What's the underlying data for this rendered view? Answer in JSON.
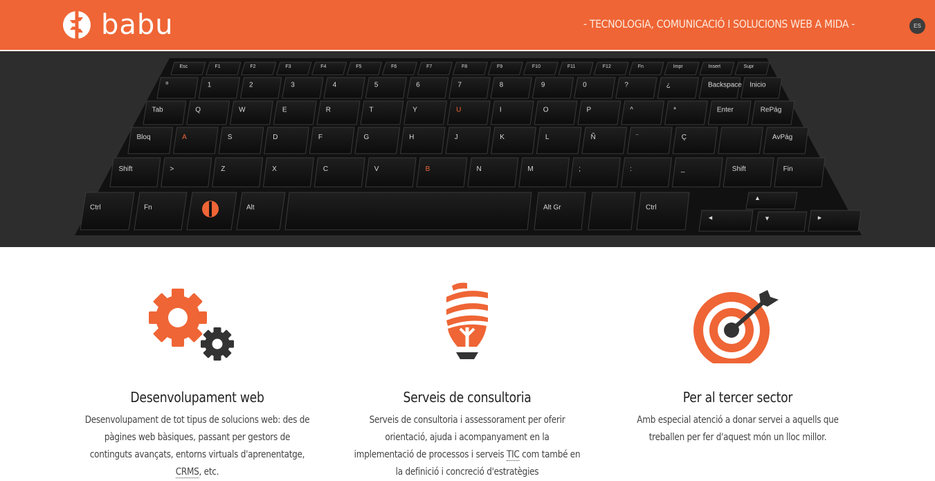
{
  "header": {
    "logo_text": "babu",
    "tagline": "- TECNOLOGIA, COMUNICACIÓ I SOLUCIONS WEB A MIDA -",
    "lang_button": "ES"
  },
  "colors": {
    "accent": "#ef6535",
    "dark": "#2d2d2d"
  },
  "hero": {
    "image": "laptop-keyboard-photo"
  },
  "features": [
    {
      "icon": "gears-icon",
      "title": "Desenvolupament web",
      "text_1": "Desenvolupament de tot tipus de solucions web: des de pàgines web bàsiques, passant per gestors de continguts avançats, entorns virtuals d'aprenentatge, ",
      "abbr": "CRMS",
      "text_2": ", etc."
    },
    {
      "icon": "lightbulb-icon",
      "title": "Serveis de consultoria",
      "text_1": "Serveis de consultoria i assessorament per oferir orientació, ajuda i acompanyament en la implementació de processos i serveis ",
      "abbr": "TIC",
      "text_2": " com també en la definició i concreció d'estratègies"
    },
    {
      "icon": "target-icon",
      "title": "Per al tercer sector",
      "text_1": "Amb especial atenció a donar servei a aquells que treballen per fer d'aquest món un lloc millor."
    }
  ]
}
